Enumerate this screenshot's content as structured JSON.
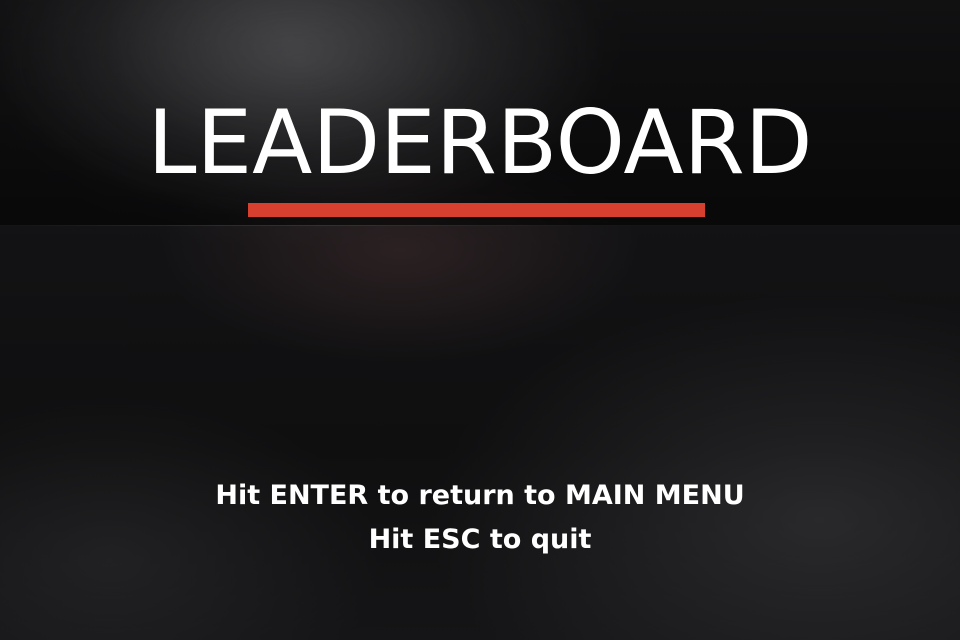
{
  "screen": {
    "title": "LEADERBOARD",
    "accent_color": "#d7402f",
    "background_color": "#121214",
    "text_color": "#ffffff"
  },
  "instructions": {
    "return_to_menu": "Hit ENTER to return to MAIN MENU",
    "quit": "Hit ESC to quit"
  }
}
